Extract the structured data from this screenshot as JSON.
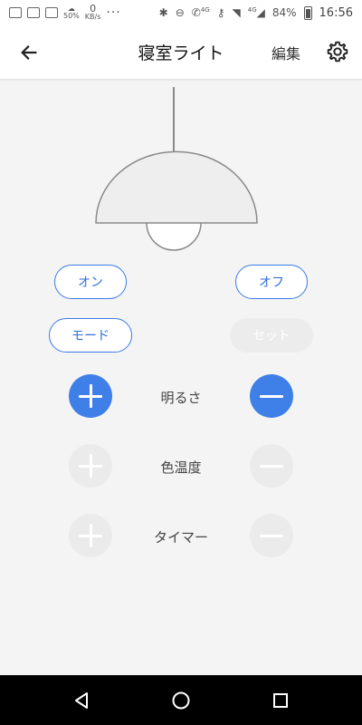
{
  "status_bar": {
    "speed_top": "0",
    "speed_unit": "KB/s",
    "percent_small": "50%",
    "more_dots": "···",
    "net_a": "4G",
    "net_b": "4G",
    "battery": "84%",
    "time": "16:56"
  },
  "header": {
    "title": "寝室ライト",
    "edit_label": "編集"
  },
  "power": {
    "on_label": "オン",
    "off_label": "オフ"
  },
  "mode": {
    "mode_label": "モード",
    "set_label": "セット"
  },
  "controls": [
    {
      "label": "明るさ",
      "enabled": true
    },
    {
      "label": "色温度",
      "enabled": false
    },
    {
      "label": "タイマー",
      "enabled": false
    }
  ],
  "colors": {
    "accent": "#3f7fe8",
    "disabled": "#ebebeb"
  },
  "icons": {
    "back": "arrow-left-icon",
    "settings": "gear-icon",
    "nav_back": "triangle-back-icon",
    "nav_home": "circle-home-icon",
    "nav_recent": "square-recent-icon"
  }
}
